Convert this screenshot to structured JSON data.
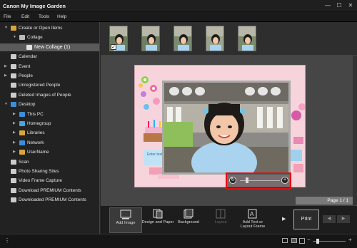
{
  "window": {
    "title": "Canon My Image Garden"
  },
  "window_controls": {
    "minimize": "—",
    "maximize": "☐",
    "close": "✕"
  },
  "menu": [
    "File",
    "Edit",
    "Tools",
    "Help"
  ],
  "tree": [
    {
      "label": "Create or Open Items",
      "level": 0,
      "arrow": "▼",
      "icon": "create-icon",
      "color": "#d9a63b"
    },
    {
      "label": "Collage",
      "level": 1,
      "arrow": "▼",
      "icon": "collage-icon",
      "color": "#bbbbbb"
    },
    {
      "label": "New Collage (1)",
      "level": 2,
      "arrow": "",
      "icon": "collage-item-icon",
      "color": "#e0e0e0",
      "selected": true
    },
    {
      "label": "Calendar",
      "level": 0,
      "arrow": "",
      "icon": "calendar-icon",
      "color": "#cccccc"
    },
    {
      "label": "Event",
      "level": 0,
      "arrow": "▶",
      "icon": "event-icon",
      "color": "#cccccc"
    },
    {
      "label": "People",
      "level": 0,
      "arrow": "▶",
      "icon": "people-icon",
      "color": "#cccccc"
    },
    {
      "label": "Unregistered People",
      "level": 0,
      "arrow": "",
      "icon": "unregistered-people-icon",
      "color": "#cccccc"
    },
    {
      "label": "Deleted Images of People",
      "level": 0,
      "arrow": "",
      "icon": "deleted-people-icon",
      "color": "#cccccc"
    },
    {
      "label": "Desktop",
      "level": 0,
      "arrow": "▼",
      "icon": "desktop-icon",
      "color": "#3a8fd8"
    },
    {
      "label": "This PC",
      "level": 1,
      "arrow": "▶",
      "icon": "this-pc-icon",
      "color": "#3a8fd8"
    },
    {
      "label": "Homegroup",
      "level": 1,
      "arrow": "▶",
      "icon": "homegroup-icon",
      "color": "#4aa3e0"
    },
    {
      "label": "Libraries",
      "level": 1,
      "arrow": "▶",
      "icon": "libraries-icon",
      "color": "#d9a63b"
    },
    {
      "label": "Network",
      "level": 1,
      "arrow": "▶",
      "icon": "network-icon",
      "color": "#3a8fd8"
    },
    {
      "label": "UserName",
      "level": 1,
      "arrow": "▶",
      "icon": "user-folder-icon",
      "color": "#d9a63b"
    },
    {
      "label": "Scan",
      "level": 0,
      "arrow": "",
      "icon": "scan-icon",
      "color": "#cccccc"
    },
    {
      "label": "Photo Sharing Sites",
      "level": 0,
      "arrow": "",
      "icon": "photo-sharing-icon",
      "color": "#cccccc"
    },
    {
      "label": "Video Frame Capture",
      "level": 0,
      "arrow": "",
      "icon": "video-capture-icon",
      "color": "#cccccc"
    },
    {
      "label": "Download PREMIUM Contents",
      "level": 0,
      "arrow": "",
      "icon": "download-premium-icon",
      "color": "#cccccc"
    },
    {
      "label": "Downloaded PREMIUM Contents",
      "level": 0,
      "arrow": "",
      "icon": "downloaded-premium-icon",
      "color": "#cccccc"
    }
  ],
  "thumbnails": [
    {
      "checked": true,
      "bg": "#6d7d5e"
    },
    {
      "checked": false,
      "bg": "#6f7d63"
    },
    {
      "checked": false,
      "bg": "#7a8a70"
    },
    {
      "checked": false,
      "bg": "#9aa38d"
    },
    {
      "checked": false,
      "bg": "#7b8a6b"
    }
  ],
  "check_mark": "✓",
  "editor": {
    "page_label": "Page 1 / 1",
    "canvas_text": "Enter text",
    "zoom_rotate_glyph": "↻",
    "zoom_plus_glyph": "+"
  },
  "toolbar": {
    "tools": [
      {
        "label": "Add Image",
        "state": "selected"
      },
      {
        "label": "Design and Paper",
        "state": "normal"
      },
      {
        "label": "Background",
        "state": "normal"
      },
      {
        "label": "Layout",
        "state": "disabled"
      },
      {
        "label": "Add Text or Layout Frame",
        "state": "normal"
      }
    ],
    "more_glyph": "▶",
    "print_label": "Print",
    "prev_glyph": "◀",
    "next_glyph": "▶"
  },
  "statusbar": {
    "menu_glyph": "⋮",
    "zoom_minus_glyph": "−",
    "zoom_plus_glyph": "+",
    "zoom_level": 0.15
  }
}
